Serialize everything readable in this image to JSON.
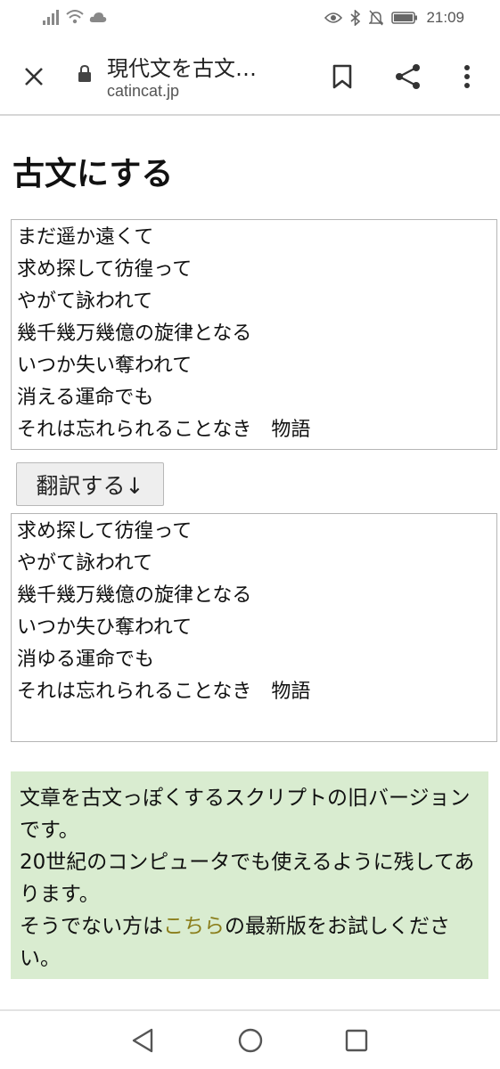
{
  "status_bar": {
    "time": "21:09",
    "icons": [
      "signal-icon",
      "wifi-icon",
      "cloud-icon",
      "eye-icon",
      "bluetooth-icon",
      "mute-icon",
      "battery-icon"
    ]
  },
  "browser": {
    "page_title": "現代文を古文…",
    "url": "catincat.jp",
    "icons": [
      "close-icon",
      "lock-icon",
      "bookmark-icon",
      "share-icon",
      "more-vert-icon"
    ]
  },
  "main": {
    "heading": "古文にする",
    "input_text": "まだ遥か遠くて\n求め探して彷徨って\nやがて詠われて\n幾千幾万幾億の旋律となる\nいつか失い奪われて\n消える運命でも\nそれは忘れられることなき　物語",
    "translate_button": "翻訳する↓",
    "output_text": "求め探して彷徨って\nやがて詠われて\n幾千幾万幾億の旋律となる\nいつか失ひ奪われて\n消ゆる運命でも\nそれは忘れられることなき　物語",
    "note": {
      "line1": "文章を古文っぽくするスクリプトの旧バージョンです。",
      "line2": "20世紀のコンピュータでも使えるように残してあります。",
      "line3_before": "そうでない方は",
      "line3_link": "こちら",
      "line3_after": "の最新版をお試しください。"
    }
  },
  "nav_bar": {
    "icons": [
      "back-icon",
      "home-icon",
      "recent-apps-icon"
    ]
  },
  "colors": {
    "note_background": "#d9ecd0",
    "link": "#8a7d1a",
    "button_background": "#eeeeee"
  }
}
